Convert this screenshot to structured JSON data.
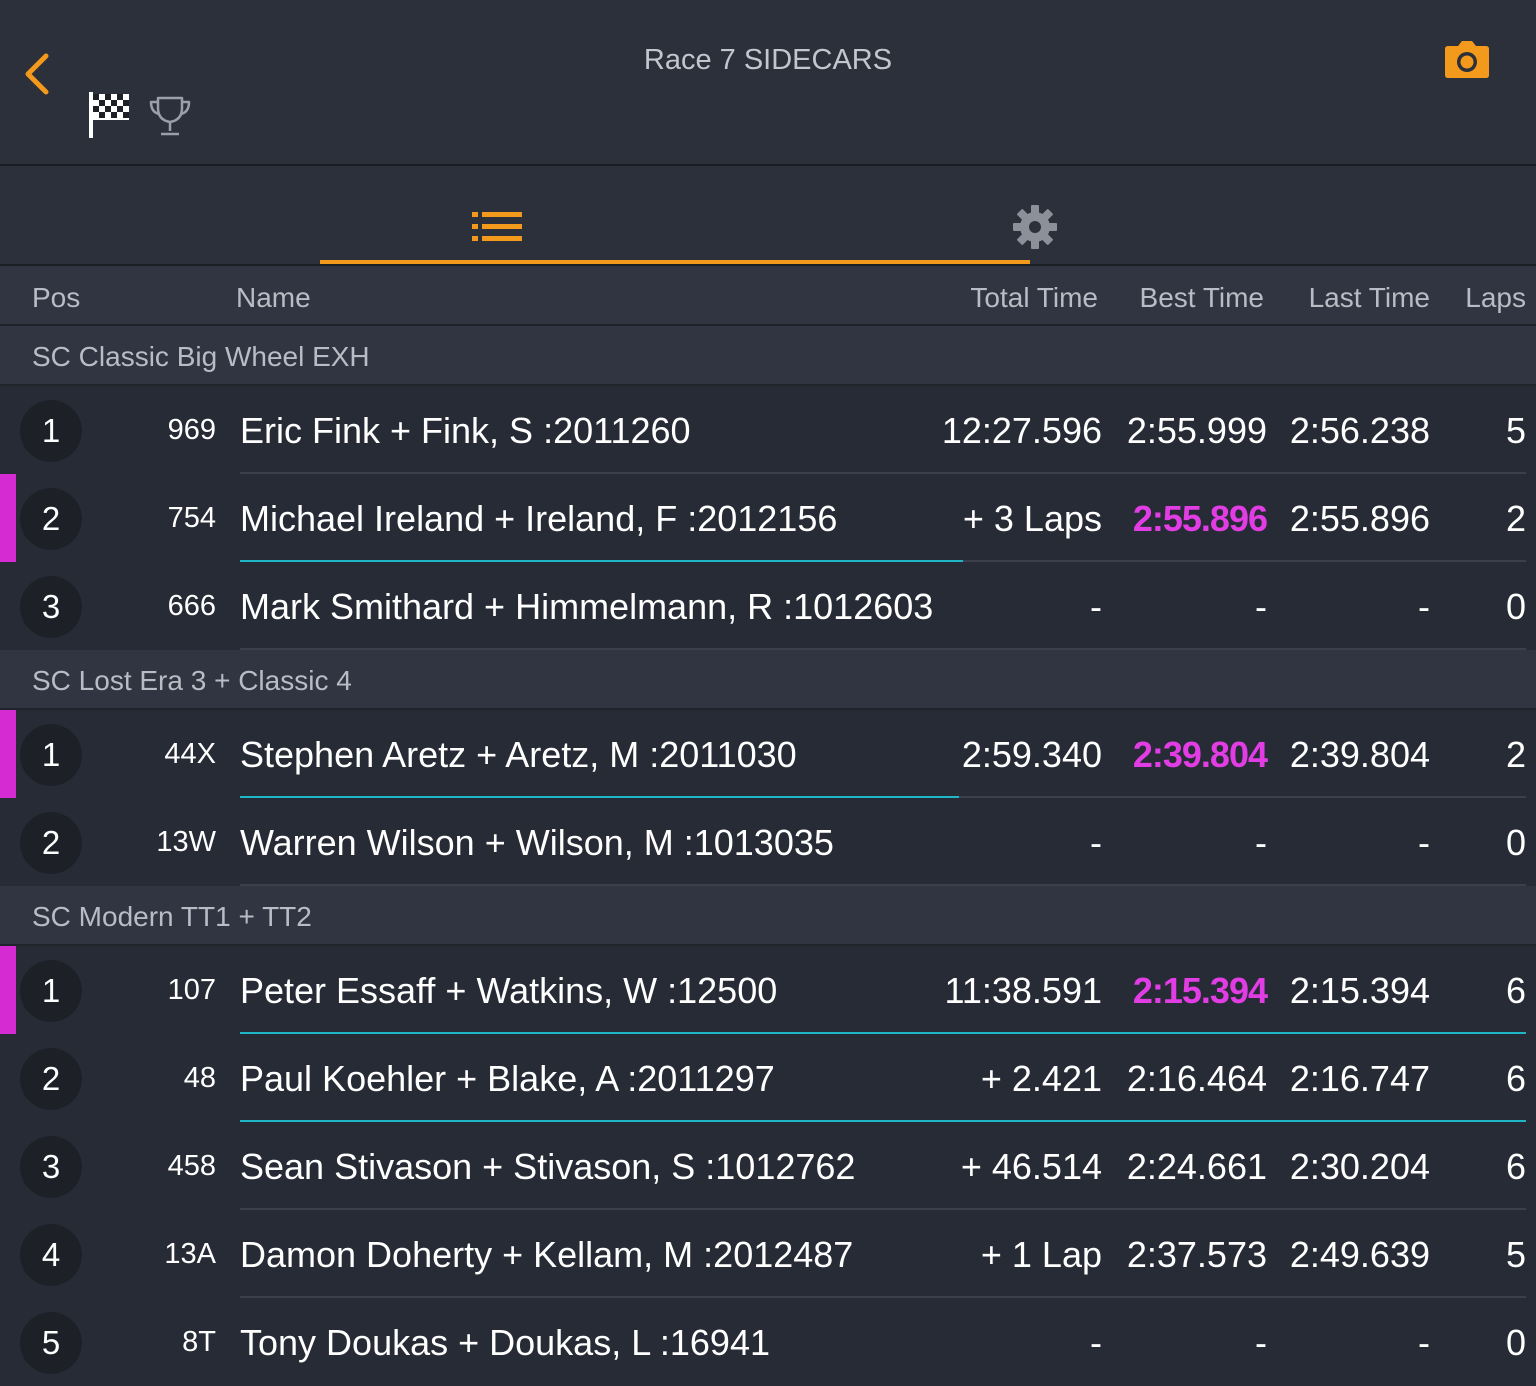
{
  "header": {
    "title": "Race 7 SIDECARS",
    "back_icon": "chevron-left-icon",
    "camera_icon": "camera-icon",
    "flag_icon": "checkered-flag-icon",
    "trophy_icon": "trophy-icon"
  },
  "tabs": [
    {
      "icon": "list-icon",
      "active": true
    },
    {
      "icon": "gear-icon",
      "active": false
    }
  ],
  "columns": {
    "pos": "Pos",
    "name": "Name",
    "total": "Total Time",
    "best": "Best Time",
    "last": "Last Time",
    "laps": "Laps"
  },
  "colors": {
    "accent": "#f39a1c",
    "fastest_lap": "#e23de4",
    "progress_line": "#1fb6c8",
    "background": "#272b35"
  },
  "groups": [
    {
      "title": "SC Classic Big Wheel EXH",
      "rows": [
        {
          "pos": "1",
          "num": "969",
          "name": "Eric Fink + Fink, S :2011260",
          "total": "12:27.596",
          "best": "2:55.999",
          "last": "2:56.238",
          "laps": "5"
        },
        {
          "pos": "2",
          "num": "754",
          "name": "Michael Ireland + Ireland, F :2012156",
          "total": "+ 3 Laps",
          "best": "2:55.896",
          "last": "2:55.896",
          "laps": "2"
        },
        {
          "pos": "3",
          "num": "666",
          "name": "Mark Smithard + Himmelmann, R :1012603",
          "total": "-",
          "best": "-",
          "last": "-",
          "laps": "0"
        }
      ]
    },
    {
      "title": "SC Lost Era 3 + Classic 4",
      "rows": [
        {
          "pos": "1",
          "num": "44X",
          "name": "Stephen Aretz + Aretz, M :2011030",
          "total": "2:59.340",
          "best": "2:39.804",
          "last": "2:39.804",
          "laps": "2"
        },
        {
          "pos": "2",
          "num": "13W",
          "name": "Warren Wilson + Wilson, M :1013035",
          "total": "-",
          "best": "-",
          "last": "-",
          "laps": "0"
        }
      ]
    },
    {
      "title": "SC Modern TT1 + TT2",
      "rows": [
        {
          "pos": "1",
          "num": "107",
          "name": "Peter Essaff + Watkins, W :12500",
          "total": "11:38.591",
          "best": "2:15.394",
          "last": "2:15.394",
          "laps": "6"
        },
        {
          "pos": "2",
          "num": "48",
          "name": "Paul Koehler + Blake, A :2011297",
          "total": "+ 2.421",
          "best": "2:16.464",
          "last": "2:16.747",
          "laps": "6"
        },
        {
          "pos": "3",
          "num": "458",
          "name": "Sean Stivason + Stivason, S :1012762",
          "total": "+ 46.514",
          "best": "2:24.661",
          "last": "2:30.204",
          "laps": "6"
        },
        {
          "pos": "4",
          "num": "13A",
          "name": "Damon Doherty + Kellam, M :2012487",
          "total": "+ 1 Lap",
          "best": "2:37.573",
          "last": "2:49.639",
          "laps": "5"
        },
        {
          "pos": "5",
          "num": "8T",
          "name": "Tony Doukas + Doukas, L :16941",
          "total": "-",
          "best": "-",
          "last": "-",
          "laps": "0"
        }
      ]
    }
  ]
}
